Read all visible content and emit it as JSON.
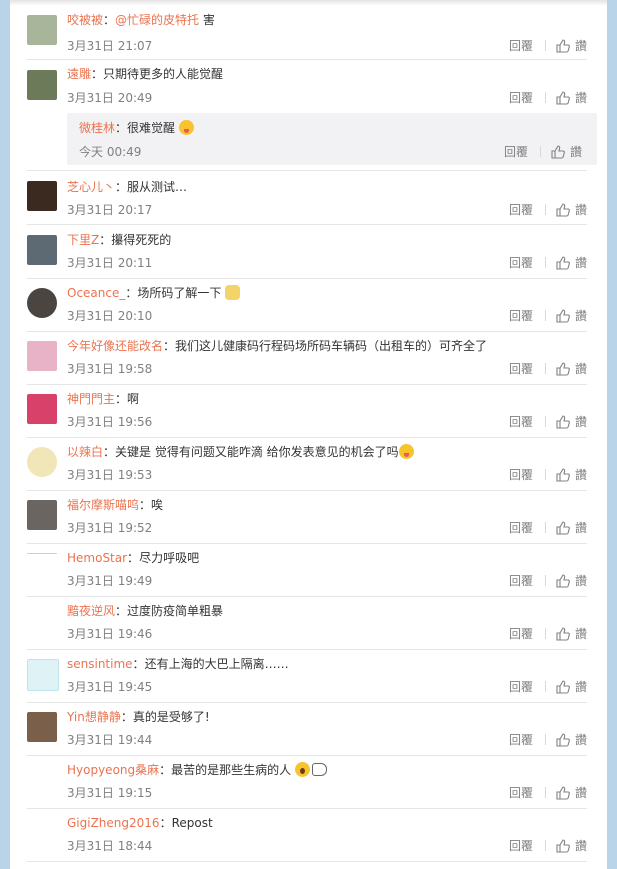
{
  "actions": {
    "reply": "回覆",
    "like": "讚"
  },
  "comments": [
    {
      "user": "咬被被",
      "mention": "@忙碌的皮特托",
      "text": " 害",
      "time": "3月31日 21:07",
      "avatar": "#a8b59a"
    },
    {
      "user": "遠雕",
      "text": "只期待更多的人能觉醒",
      "time": "3月31日 20:49",
      "avatar": "#6d7a5a"
    },
    {
      "user": "芝心儿丶",
      "text": "服从测试…",
      "time": "3月31日 20:17",
      "avatar": "#3a2a20"
    },
    {
      "user": "下里Z",
      "text": "攥得死死的",
      "time": "3月31日 20:11",
      "avatar": "#5e6a73"
    },
    {
      "user": "Oceance_",
      "text": "场所码了解一下",
      "time": "3月31日 20:10",
      "avatar": "#4a4541"
    },
    {
      "user": "今年好像还能改名",
      "text": "我们这儿健康码行程码场所码车辆码（出租车的）可齐全了",
      "time": "3月31日 19:58",
      "avatar": "#e8b3c6"
    },
    {
      "user": "神門門主",
      "text": "啊",
      "time": "3月31日 19:56",
      "avatar": "#d8426a"
    },
    {
      "user": "以辣白",
      "text": "关键是 觉得有问题又能咋滴 给你发表意见的机会了吗",
      "time": "3月31日 19:53",
      "avatar": "#f0e6b8"
    },
    {
      "user": "福尔摩斯喵呜",
      "text": "唉",
      "time": "3月31日 19:52",
      "avatar": "#6a6560"
    },
    {
      "user": "HemoStar",
      "text": "尽力呼吸吧",
      "time": "3月31日 19:49",
      "avatar": "#cfcfcf"
    },
    {
      "user": "黯夜逆风",
      "text": "过度防疫简单粗暴",
      "time": "3月31日 19:46",
      "avatar": "#ffffff"
    },
    {
      "user": "sensintime",
      "text": "还有上海的大巴上隔离……",
      "time": "3月31日 19:45",
      "avatar": "#dff2f5"
    },
    {
      "user": "Yin想静静",
      "text": "真的是受够了!",
      "time": "3月31日 19:44",
      "avatar": "#7a5f4a"
    },
    {
      "user": "Hyopyeong桑麻",
      "text": "最苦的是那些生病的人",
      "time": "3月31日 19:15",
      "avatar": "#ffffff"
    },
    {
      "user": "GigiZheng2016",
      "text": "Repost",
      "time": "3月31日 18:44",
      "avatar": "#ffffff"
    }
  ],
  "reply": {
    "user": "微桂林",
    "text": "很难觉醒",
    "time": "今天 00:49"
  }
}
